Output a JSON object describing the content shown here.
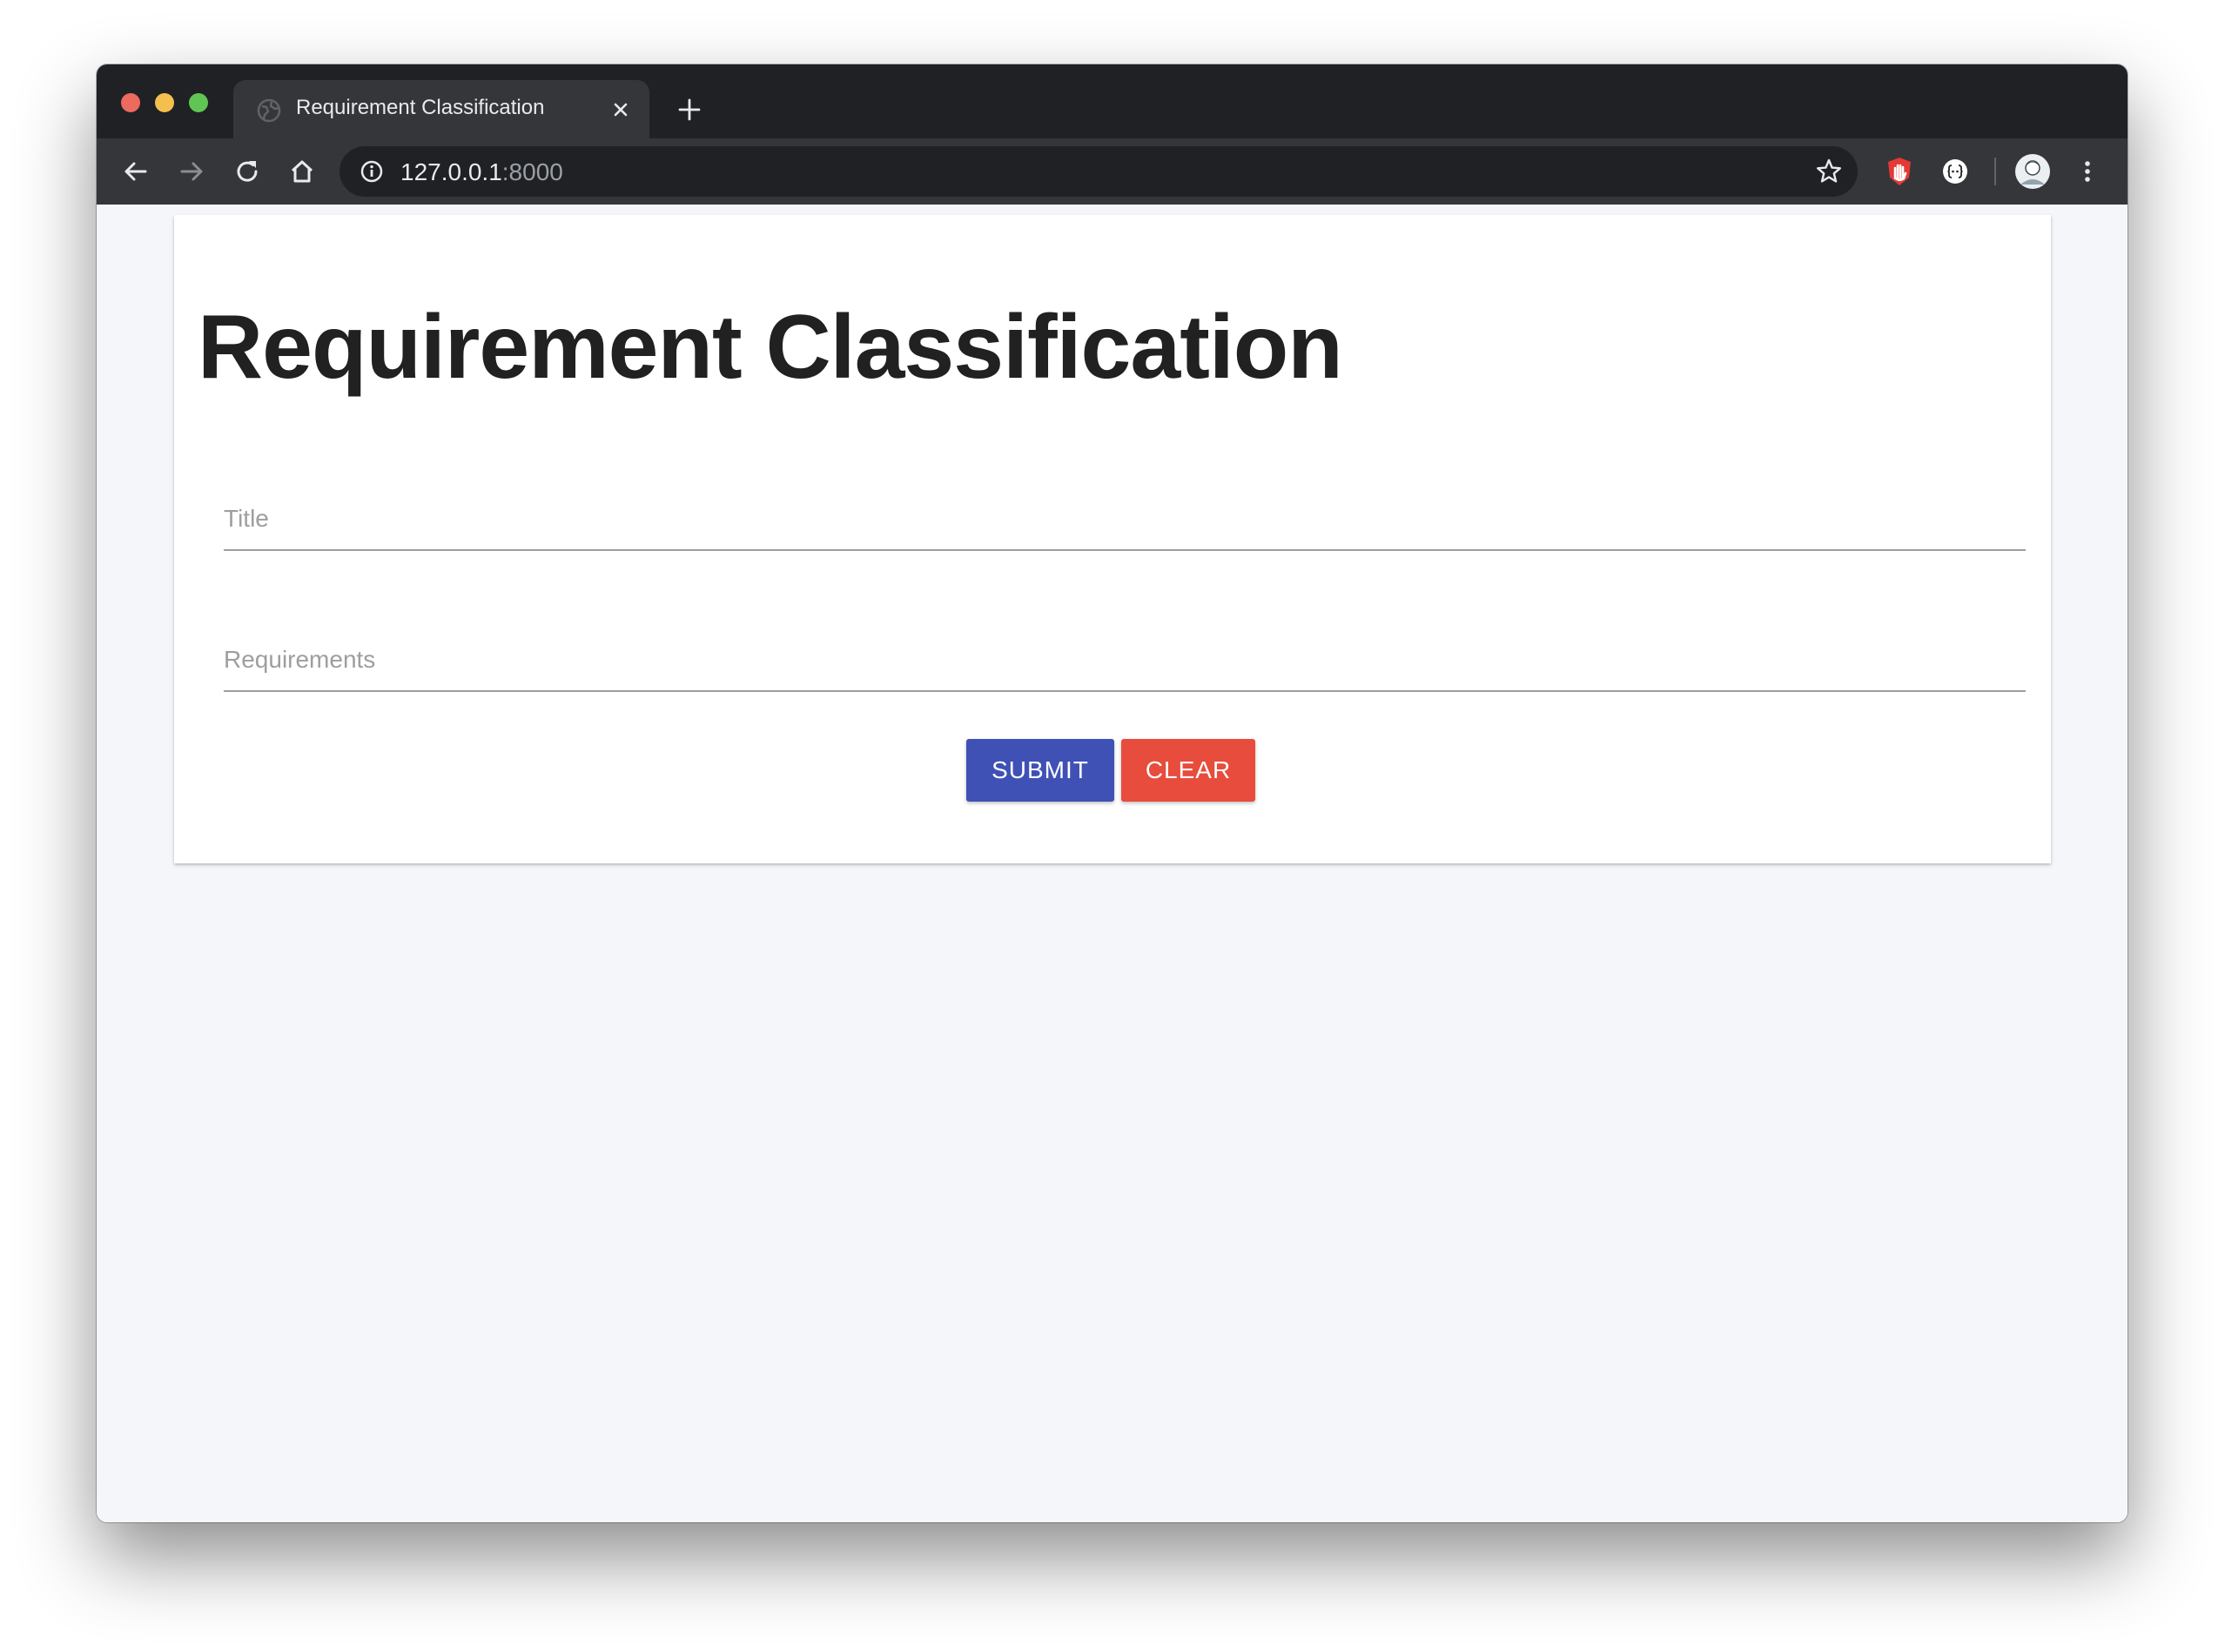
{
  "browser": {
    "tab_title": "Requirement Classification",
    "url_host": "127.0.0.1",
    "url_port": ":8000",
    "icons": {
      "back": "arrow-left-icon",
      "forward": "arrow-right-icon",
      "reload": "reload-icon",
      "home": "home-icon",
      "site_info": "info-icon",
      "bookmark": "star-icon",
      "new_tab": "plus-icon",
      "close_tab": "close-icon",
      "extension_1": "hand-stop-icon",
      "extension_2": "json-braces-icon",
      "profile": "avatar",
      "menu": "more-vertical-icon"
    }
  },
  "page": {
    "title": "Requirement Classification",
    "form": {
      "title_placeholder": "Title",
      "requirements_placeholder": "Requirements",
      "submit_label": "SUBMIT",
      "clear_label": "CLEAR"
    }
  },
  "colors": {
    "submit": "#3f51b5",
    "clear": "#e74c3c",
    "page_background": "#f5f6fa",
    "browser_frame": "#202124",
    "toolbar": "#35363a"
  }
}
